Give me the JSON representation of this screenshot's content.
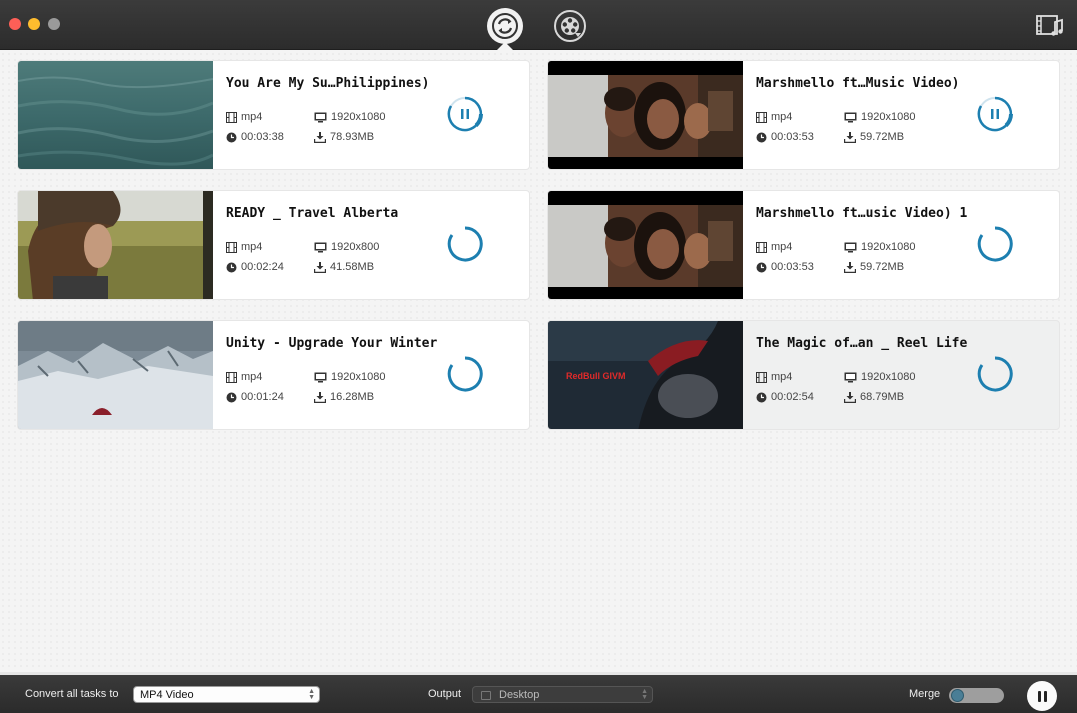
{
  "toolbar": {
    "mode_convert_icon": "convert-cycle-icon",
    "mode_download_icon": "film-reel-download-icon",
    "toolbox_icon": "film-music-toolbox-icon"
  },
  "tasks": [
    {
      "title": "You Are My Su…Philippines)",
      "format": "mp4",
      "resolution": "1920x1080",
      "duration": "00:03:38",
      "size": "78.93MB",
      "status": "paused-progress"
    },
    {
      "title": "Marshmello ft…Music Video)",
      "format": "mp4",
      "resolution": "1920x1080",
      "duration": "00:03:53",
      "size": "59.72MB",
      "status": "paused-progress"
    },
    {
      "title": "READY _ Travel Alberta",
      "format": "mp4",
      "resolution": "1920x800",
      "duration": "00:02:24",
      "size": "41.58MB",
      "status": "loading"
    },
    {
      "title": "Marshmello ft…usic Video) 1",
      "format": "mp4",
      "resolution": "1920x1080",
      "duration": "00:03:53",
      "size": "59.72MB",
      "status": "loading"
    },
    {
      "title": "Unity - Upgrade Your Winter",
      "format": "mp4",
      "resolution": "1920x1080",
      "duration": "00:01:24",
      "size": "16.28MB",
      "status": "loading"
    },
    {
      "title": "The Magic of…an _ Reel Life",
      "format": "mp4",
      "resolution": "1920x1080",
      "duration": "00:02:54",
      "size": "68.79MB",
      "status": "loading"
    }
  ],
  "bottom": {
    "convert_label": "Convert all tasks to",
    "convert_value": "MP4 Video",
    "output_label": "Output",
    "output_value": "Desktop",
    "merge_label": "Merge",
    "merge_on": false
  },
  "colors": {
    "accent": "#1d7fb0",
    "titlebar": "#333333",
    "traffic_red": "#fd5f57",
    "traffic_yellow": "#febc2e",
    "traffic_gray": "#9a9a9a"
  },
  "thumb_text": "RedBull GIVM"
}
